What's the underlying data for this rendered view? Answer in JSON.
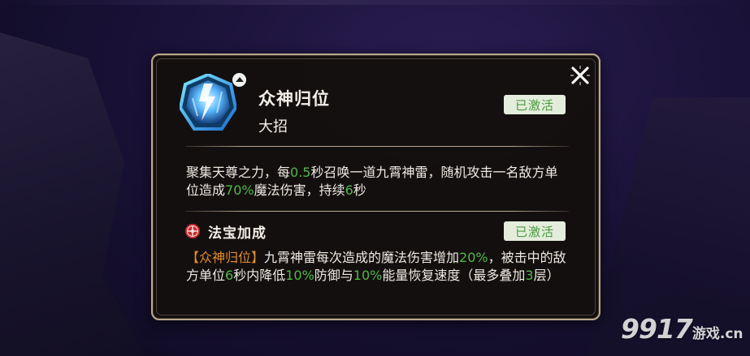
{
  "skill": {
    "name": "众神归位",
    "type": "大招",
    "icon": "lightning-skill-icon",
    "status": "已激活",
    "description": [
      {
        "text": "聚集天尊之力，每",
        "hl": false
      },
      {
        "text": "0.5",
        "hl": true
      },
      {
        "text": "秒召唤一道九霄神雷，随机攻击一名敌方单位造成",
        "hl": false
      },
      {
        "text": "70%",
        "hl": true
      },
      {
        "text": "魔法伤害，持续",
        "hl": false
      },
      {
        "text": "6",
        "hl": true
      },
      {
        "text": "秒",
        "hl": false
      }
    ]
  },
  "treasure": {
    "title": "法宝加成",
    "icon": "treasure-seal-icon",
    "status": "已激活",
    "tag": "【众神归位】",
    "description": [
      {
        "text": "九霄神雷每次造成的魔法伤害增加",
        "hl": false
      },
      {
        "text": "20%",
        "hl": true
      },
      {
        "text": "，被击中的敌方单位",
        "hl": false
      },
      {
        "text": "6",
        "hl": true
      },
      {
        "text": "秒内降低",
        "hl": false
      },
      {
        "text": "10%",
        "hl": true
      },
      {
        "text": "防御与",
        "hl": false
      },
      {
        "text": "10%",
        "hl": true
      },
      {
        "text": "能量恢复速度（最多叠加",
        "hl": false
      },
      {
        "text": "3",
        "hl": true
      },
      {
        "text": "层）",
        "hl": false
      }
    ]
  },
  "close_icon": "close-icon",
  "watermark": {
    "main": "9917",
    "sub": "游戏",
    "domain": ".cn"
  },
  "colors": {
    "highlight": "#4fb846",
    "tag": "#e08c2f",
    "badge_bg": "#e4eddc",
    "badge_text": "#4b9a40",
    "border": "#b9a88e"
  }
}
